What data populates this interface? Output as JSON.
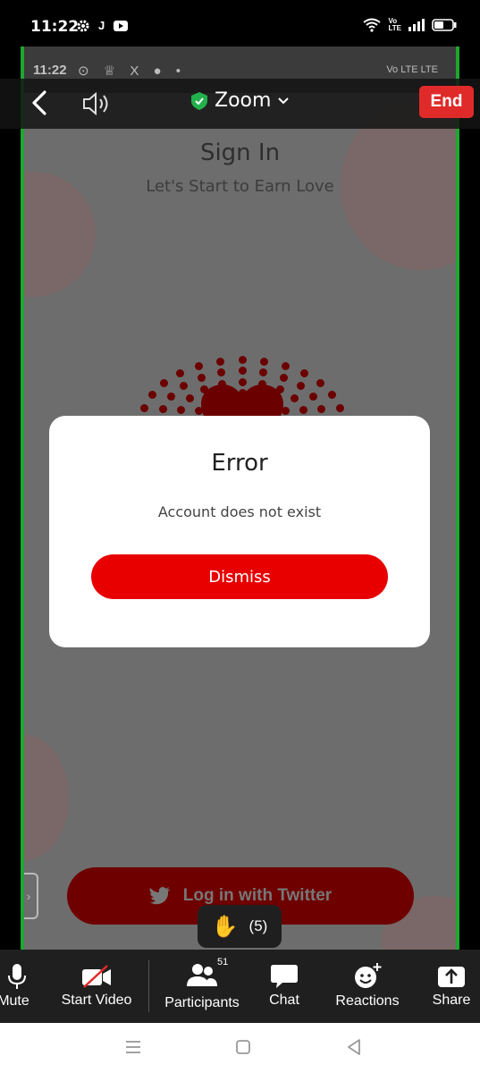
{
  "status_bar": {
    "time": "11:22",
    "left_icons": [
      "gear-icon",
      "j-icon",
      "youtube-icon"
    ],
    "right_icons": [
      "wifi-icon",
      "volte-icon",
      "signal-icon",
      "battery-icon"
    ]
  },
  "shared_screen": {
    "inner_status": {
      "time": "11:22",
      "icons_text": "⊙ ♕ X ● •",
      "right_text": "Vo LTE LTE"
    },
    "signin_title": "Sign In",
    "signin_subtitle": "Let's Start to Earn Love",
    "twitter_button": "Log in with Twitter",
    "accent": "#1fa531"
  },
  "zoom_header": {
    "title": "Zoom",
    "end_label": "End",
    "end_color": "#e02a2a"
  },
  "dialog": {
    "title": "Error",
    "message": "Account does not exist",
    "dismiss_label": "Dismiss",
    "button_color": "#e80000"
  },
  "raise_hand": {
    "count": "(5)"
  },
  "toolbar": {
    "mute": "Mute",
    "start_video": "Start Video",
    "participants": "Participants",
    "participants_count": "51",
    "chat": "Chat",
    "reactions": "Reactions",
    "share": "Share"
  }
}
